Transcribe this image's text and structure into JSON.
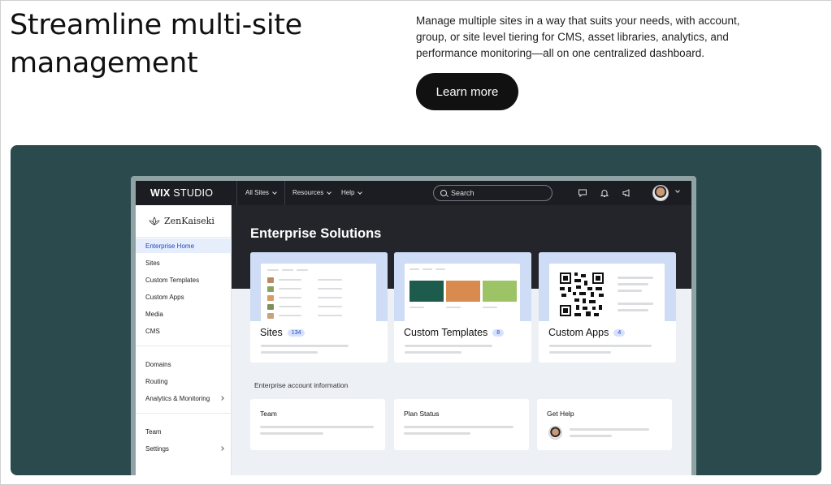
{
  "hero": {
    "title": "Streamline multi-site management",
    "description": "Manage multiple sites in a way that suits your needs, with account, group, or site level tiering for CMS, asset libraries, analytics, and performance monitoring—all on one centralized dashboard.",
    "cta_label": "Learn more"
  },
  "app": {
    "logo_bold": "WIX",
    "logo_thin": "STUDIO",
    "menus": [
      {
        "label": "All Sites"
      },
      {
        "label": "Resources"
      },
      {
        "label": "Help"
      }
    ],
    "search_placeholder": "Search",
    "icons": [
      "chat-icon",
      "bell-icon",
      "megaphone-icon"
    ]
  },
  "sidebar": {
    "brand": "ZenKaiseki",
    "items": [
      {
        "label": "Enterprise Home",
        "active": true
      },
      {
        "label": "Sites"
      },
      {
        "label": "Custom Templates"
      },
      {
        "label": "Custom Apps"
      },
      {
        "label": "Media"
      },
      {
        "label": "CMS"
      },
      {
        "label": "Domains"
      },
      {
        "label": "Routing"
      },
      {
        "label": "Analytics & Monitoring"
      },
      {
        "label": "Team"
      },
      {
        "label": "Settings"
      }
    ]
  },
  "main": {
    "title": "Enterprise Solutions",
    "cards": [
      {
        "title": "Sites",
        "count": "134"
      },
      {
        "title": "Custom Templates",
        "count": "8"
      },
      {
        "title": "Custom Apps",
        "count": "4"
      }
    ],
    "account_label": "Enterprise account information",
    "info_cards": [
      {
        "title": "Team"
      },
      {
        "title": "Plan Status"
      },
      {
        "title": "Get Help"
      }
    ]
  },
  "colors": {
    "panel": "#2b4a4d",
    "topbar": "#1b1d22",
    "accent": "#1f46c7",
    "card_top": "#cfdcf6"
  }
}
